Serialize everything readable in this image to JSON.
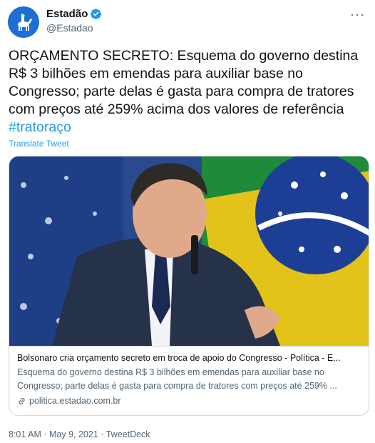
{
  "account": {
    "name": "Estadão",
    "handle": "@Estadao"
  },
  "tweet": {
    "text": "ORÇAMENTO SECRETO: Esquema do governo destina R$ 3 bilhões em emendas para auxiliar base no Congresso; parte delas é gasta para compra de tratores com preços até 259% acima dos valores de referência",
    "hashtag": "#tratoraço",
    "translate_label": "Translate Tweet"
  },
  "card": {
    "title": "Bolsonaro cria orçamento secreto em troca de apoio do Congresso - Política - E...",
    "description": "Esquema do governo destina R$ 3 bilhões em emendas para auxiliar base no Congresso; parte delas é gasta para compra de tratores com preços até 259% ...",
    "domain": "politica.estadao.com.br"
  },
  "meta": {
    "time": "8:01 AM",
    "date": "May 9, 2021",
    "source": "TweetDeck",
    "separator": "·"
  },
  "icons": {
    "verified": "verified-badge-icon",
    "more": "more-icon",
    "link": "link-icon"
  },
  "colors": {
    "link_blue": "#1d9bf0",
    "secondary_text": "#536471",
    "avatar_blue": "#1d6fd1"
  }
}
